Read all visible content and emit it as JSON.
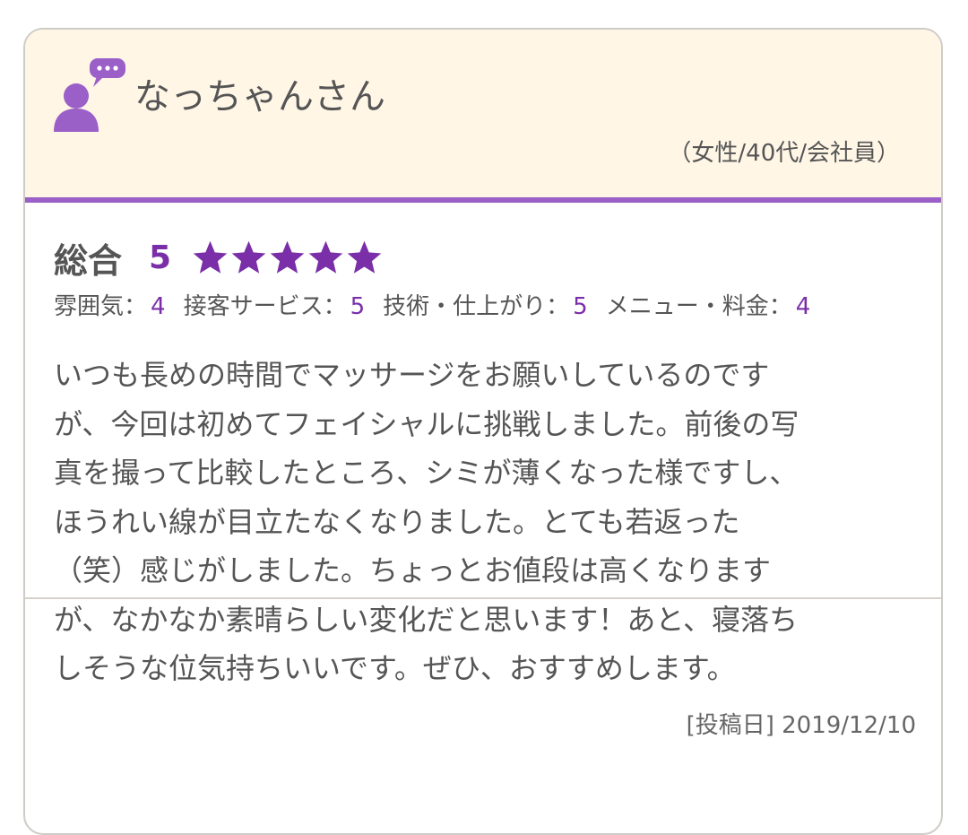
{
  "reviewer": {
    "name": "なっちゃんさん",
    "profile": "（女性/40代/会社員）"
  },
  "rating": {
    "overall_label": "総合",
    "overall_score": "5",
    "overall_stars": 5,
    "star_color": "#7a2fa8",
    "items": [
      {
        "label": "雰囲気：",
        "value": "4"
      },
      {
        "label": "接客サービス：",
        "value": "5"
      },
      {
        "label": "技術・仕上がり：",
        "value": "5"
      },
      {
        "label": "メニュー・料金：",
        "value": "4"
      }
    ]
  },
  "review": {
    "lines": [
      "いつも長めの時間でマッサージをお願いしているのです",
      "が、今回は初めてフェイシャルに挑戦しました。前後の写",
      "真を撮って比較したところ、シミが薄くなった様ですし、",
      "ほうれい線が目立たなくなりました。とても若返った",
      "（笑）感じがしました。ちょっとお値段は高くなります",
      "が、なかなか素晴らしい変化だと思います！あと、寝落ち",
      "しそうな位気持ちいいです。ぜひ、おすすめします。"
    ]
  },
  "post_date": "[投稿日] 2019/12/10",
  "colors": {
    "accent": "#9b5fc8",
    "header_bg": "#fff6e6",
    "score": "#7a2fa8"
  },
  "icons": {
    "avatar": "user-speech-bubble-icon",
    "star": "star-icon"
  }
}
